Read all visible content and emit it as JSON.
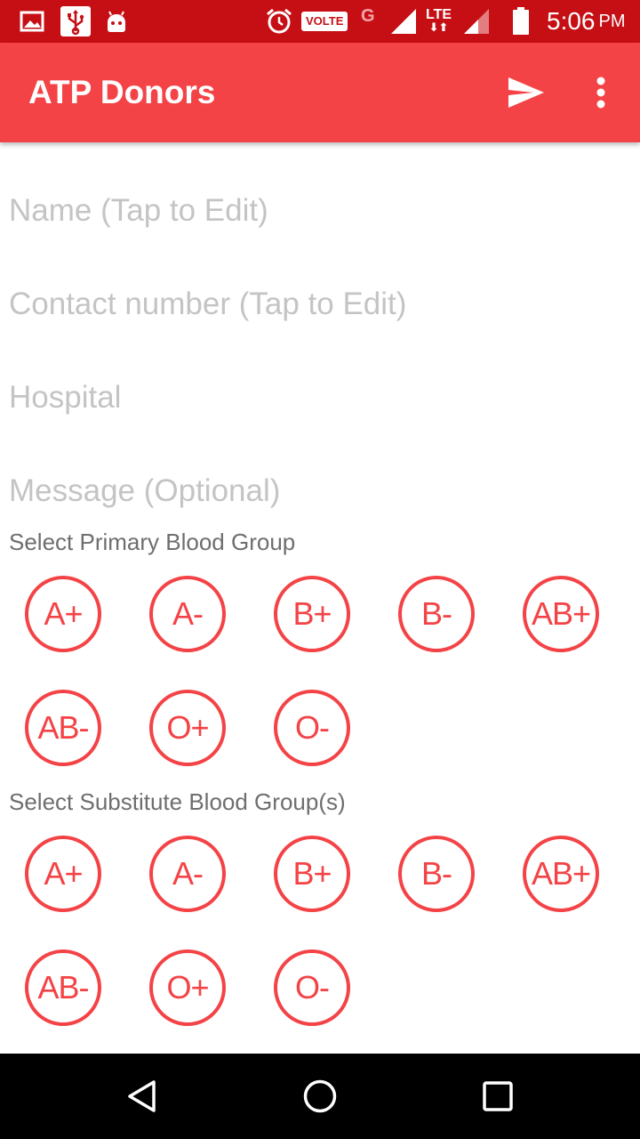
{
  "status_bar": {
    "volte": "VOLTE",
    "network_g": "G",
    "lte": "LTE",
    "time": "5:06",
    "ampm": "PM",
    "icons": [
      "gallery-icon",
      "usb-icon",
      "android-icon",
      "alarm-icon",
      "signal-icon",
      "battery-icon"
    ]
  },
  "app_bar": {
    "title": "ATP Donors",
    "actions": [
      "send-icon",
      "more-vert-icon"
    ],
    "color": "#f44346"
  },
  "form": {
    "name_placeholder": "Name (Tap to Edit)",
    "contact_placeholder": "Contact number (Tap to Edit)",
    "hospital_placeholder": "Hospital",
    "message_placeholder": "Message (Optional)"
  },
  "primary": {
    "label": "Select Primary Blood Group",
    "groups": [
      "A+",
      "A-",
      "B+",
      "B-",
      "AB+",
      "AB-",
      "O+",
      "O-"
    ]
  },
  "substitute": {
    "label": "Select Substitute Blood Group(s)",
    "groups": [
      "A+",
      "A-",
      "B+",
      "B-",
      "AB+",
      "AB-",
      "O+",
      "O-"
    ]
  },
  "nav_bar": {
    "buttons": [
      "back-icon",
      "home-icon",
      "recents-icon"
    ]
  }
}
